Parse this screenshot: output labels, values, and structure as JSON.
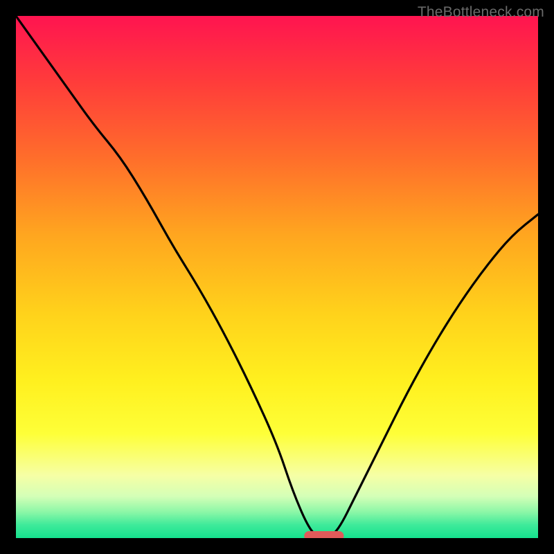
{
  "watermark": "TheBottleneck.com",
  "chart_data": {
    "type": "line",
    "title": "",
    "xlabel": "",
    "ylabel": "",
    "xlim": [
      0,
      100
    ],
    "ylim": [
      0,
      100
    ],
    "x": [
      0,
      5,
      10,
      15,
      20,
      25,
      30,
      35,
      40,
      45,
      50,
      53,
      56,
      58,
      60,
      62,
      65,
      70,
      75,
      80,
      85,
      90,
      95,
      100
    ],
    "values": [
      100,
      93,
      86,
      79,
      73,
      65,
      56,
      48,
      39,
      29,
      18,
      9,
      2,
      0,
      0,
      2,
      8,
      18,
      28,
      37,
      45,
      52,
      58,
      62
    ],
    "optimal_range_x": [
      56,
      62
    ],
    "optimal_band_y": 0,
    "gradient_stops": [
      {
        "pct": 0,
        "color": "#ff1450"
      },
      {
        "pct": 13,
        "color": "#ff3d3a"
      },
      {
        "pct": 27,
        "color": "#ff6d2b"
      },
      {
        "pct": 42,
        "color": "#ffa61f"
      },
      {
        "pct": 57,
        "color": "#ffd21b"
      },
      {
        "pct": 70,
        "color": "#fff01f"
      },
      {
        "pct": 80,
        "color": "#feff38"
      },
      {
        "pct": 88,
        "color": "#f6ffa5"
      },
      {
        "pct": 92,
        "color": "#d4ffb7"
      },
      {
        "pct": 95,
        "color": "#8cf7a7"
      },
      {
        "pct": 97.5,
        "color": "#3eea9a"
      },
      {
        "pct": 100,
        "color": "#15e28e"
      }
    ]
  }
}
